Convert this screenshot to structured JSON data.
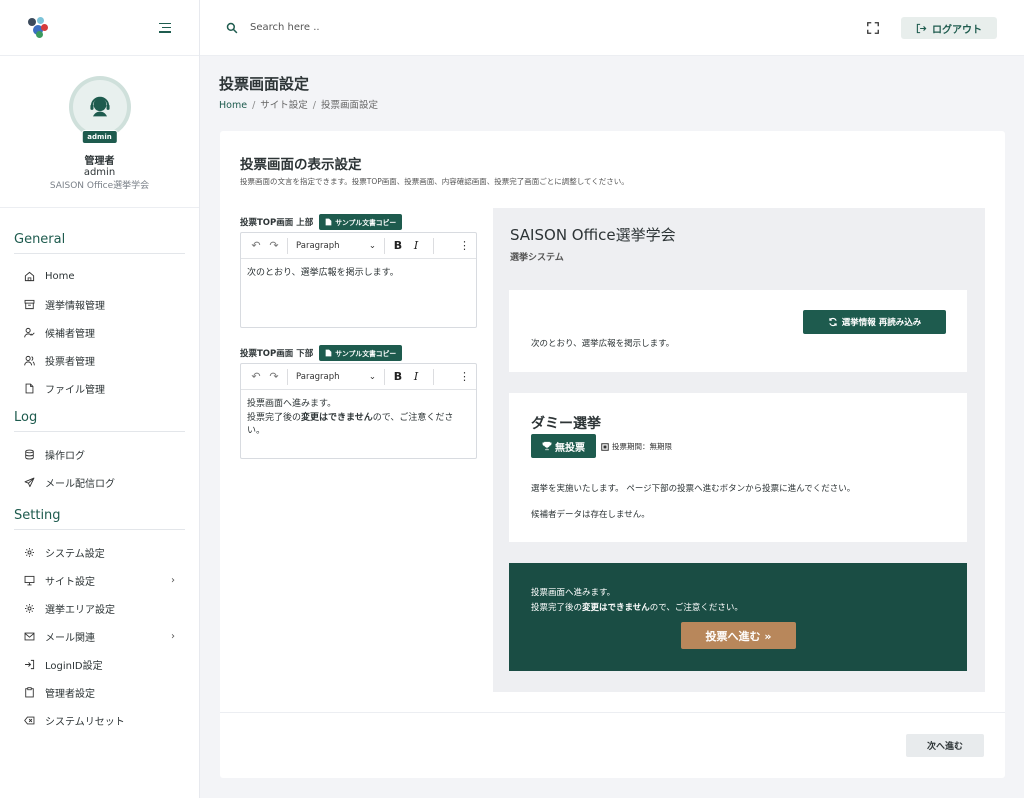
{
  "sidebar": {
    "profile": {
      "badge": "admin",
      "name": "管理者",
      "role": "admin",
      "org": "SAISON Office選挙学会"
    },
    "sections": [
      {
        "heading": "General",
        "items": [
          {
            "label": "Home",
            "icon": "home-icon"
          },
          {
            "label": "選挙情報管理",
            "icon": "archive-icon"
          },
          {
            "label": "候補者管理",
            "icon": "user-check-icon"
          },
          {
            "label": "投票者管理",
            "icon": "users-icon"
          },
          {
            "label": "ファイル管理",
            "icon": "file-icon"
          }
        ]
      },
      {
        "heading": "Log",
        "items": [
          {
            "label": "操作ログ",
            "icon": "database-icon"
          },
          {
            "label": "メール配信ログ",
            "icon": "send-icon"
          }
        ]
      },
      {
        "heading": "Setting",
        "items": [
          {
            "label": "システム設定",
            "icon": "gear-icon"
          },
          {
            "label": "サイト設定",
            "icon": "monitor-icon",
            "chevron": true
          },
          {
            "label": "選挙エリア設定",
            "icon": "gear-icon"
          },
          {
            "label": "メール関連",
            "icon": "mail-icon",
            "chevron": true
          },
          {
            "label": "LoginID設定",
            "icon": "login-icon"
          },
          {
            "label": "管理者設定",
            "icon": "clipboard-icon"
          },
          {
            "label": "システムリセット",
            "icon": "backspace-icon"
          }
        ]
      }
    ]
  },
  "header": {
    "search_placeholder": "Search here ..",
    "logout_label": "ログアウト"
  },
  "page": {
    "title": "投票画面設定",
    "breadcrumb": {
      "home": "Home",
      "mid": "サイト設定",
      "current": "投票画面設定"
    }
  },
  "card": {
    "title": "投票画面の表示設定",
    "description": "投票画面の文言を指定できます。投票TOP画面、投票画面、内容確認画面、投票完了画面ごとに調整してください。",
    "editors": {
      "top": {
        "label": "投票TOP画面 上部",
        "copy_label": "サンプル文書コピー",
        "format": "Paragraph",
        "text": "次のとおり、選挙広報を掲示します。"
      },
      "bottom": {
        "label": "投票TOP画面 下部",
        "copy_label": "サンプル文書コピー",
        "format": "Paragraph",
        "line1": "投票画面へ進みます。",
        "line2_pre": "投票完了後の",
        "line2_bold": "変更はできません",
        "line2_post": "ので、ご注意ください。"
      }
    },
    "preview": {
      "title": "SAISON Office選挙学会",
      "subtitle": "選挙システム",
      "reload_label": "選挙情報 再読み込み",
      "top_text": "次のとおり、選挙広報を掲示します。",
      "election_title": "ダミー選挙",
      "no_vote_label": "無投票",
      "period": "投票期間：無期限",
      "desc1": "選挙を実施いたします。 ページ下部の投票へ進むボタンから投票に進んでください。",
      "desc2": "候補者データは存在しません。",
      "bottom_line1": "投票画面へ進みます。",
      "bottom_line2_pre": "投票完了後の",
      "bottom_line2_bold": "変更はできません",
      "bottom_line2_post": "ので、ご注意ください。",
      "vote_label": "投票へ進む »"
    },
    "next_label": "次へ進む"
  },
  "colors": {
    "accent": "#1e5b4e",
    "dark_panel": "#1a4d44",
    "vote_button": "#b8875b"
  }
}
